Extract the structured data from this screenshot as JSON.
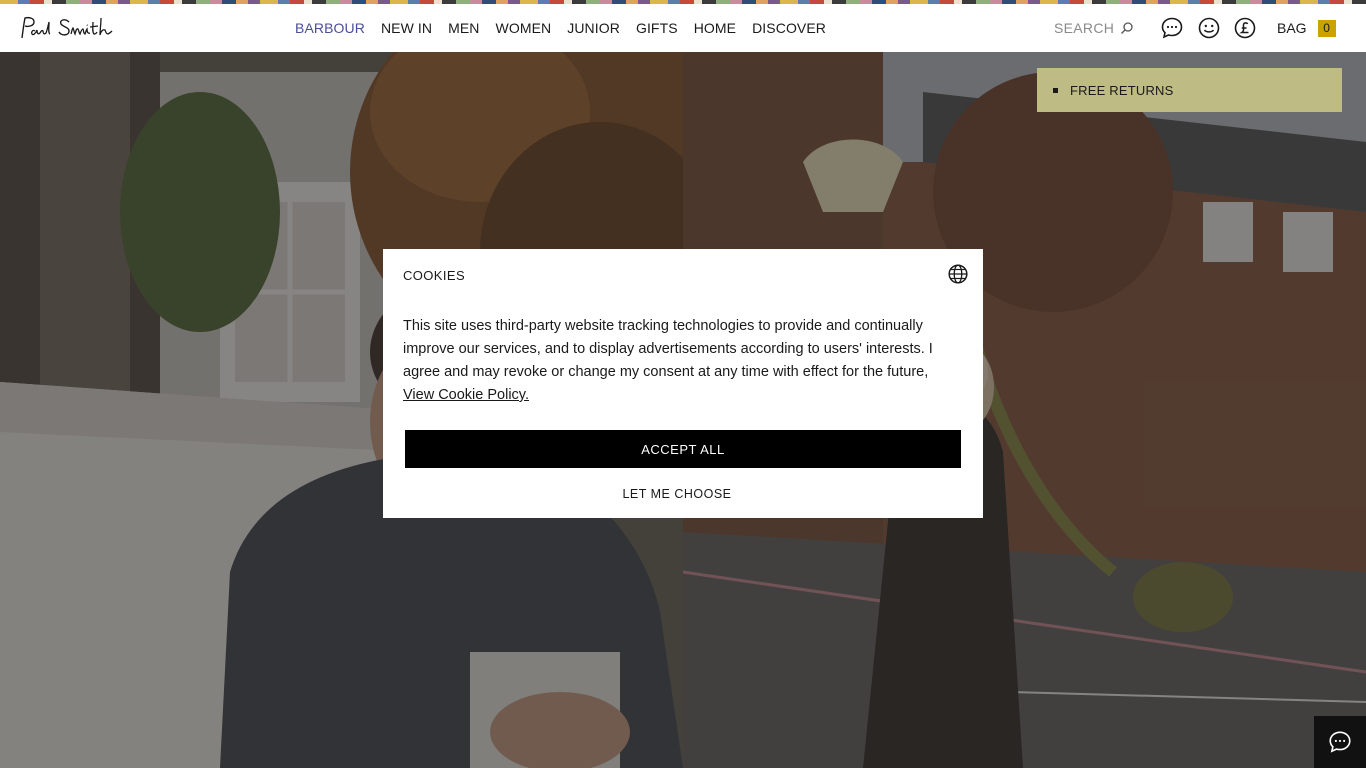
{
  "brand": {
    "logo_text": "Paul Smith"
  },
  "nav": {
    "items": [
      {
        "label": "BARBOUR",
        "active": true
      },
      {
        "label": "NEW IN"
      },
      {
        "label": "MEN"
      },
      {
        "label": "WOMEN"
      },
      {
        "label": "JUNIOR"
      },
      {
        "label": "GIFTS"
      },
      {
        "label": "HOME"
      },
      {
        "label": "DISCOVER"
      }
    ]
  },
  "search": {
    "label": "SEARCH",
    "icon": "search-icon"
  },
  "header_icons": [
    "chat-bubble-icon",
    "smiley-account-icon",
    "pound-currency-icon"
  ],
  "bag": {
    "label": "BAG",
    "count": "0"
  },
  "promo": {
    "text": "FREE RETURNS"
  },
  "cookie_modal": {
    "title": "COOKIES",
    "body": "This site uses third-party website tracking technologies to provide and continually improve our services, and to display advertisements according to users' interests. I agree and may revoke or change my consent at any time with effect for the future,",
    "link": "View Cookie Policy.",
    "accept_label": "ACCEPT ALL",
    "choose_label": "LET ME CHOOSE",
    "language_icon": "globe-icon"
  },
  "colors": {
    "nav_active": "#4a4f96",
    "bag_badge": "#c9a400",
    "promo_bg": "#bebb85",
    "accept_bg": "#000000"
  }
}
